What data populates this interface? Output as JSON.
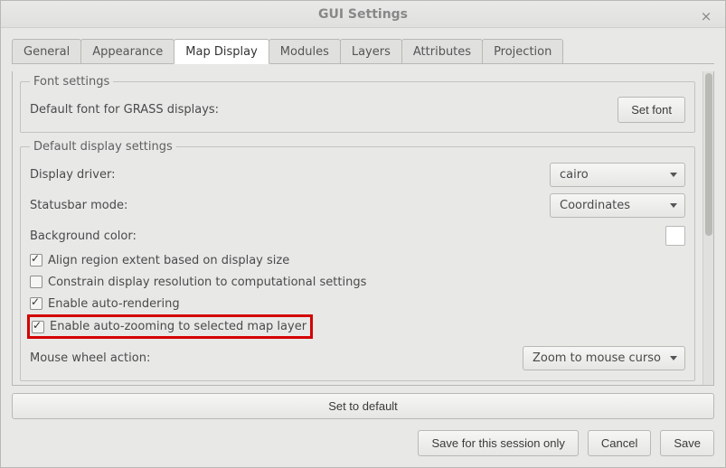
{
  "window": {
    "title": "GUI Settings"
  },
  "tabs": [
    {
      "label": "General"
    },
    {
      "label": "Appearance"
    },
    {
      "label": "Map Display"
    },
    {
      "label": "Modules"
    },
    {
      "label": "Layers"
    },
    {
      "label": "Attributes"
    },
    {
      "label": "Projection"
    }
  ],
  "active_tab_index": 2,
  "font_settings": {
    "legend": "Font settings",
    "default_font_label": "Default font for GRASS displays:",
    "set_font_button": "Set font"
  },
  "display_settings": {
    "legend": "Default display settings",
    "driver_label": "Display driver:",
    "driver_value": "cairo",
    "statusbar_label": "Statusbar mode:",
    "statusbar_value": "Coordinates",
    "bg_color_label": "Background color:",
    "bg_color_value": "#ffffff",
    "check_align": {
      "label": "Align region extent based on display size",
      "checked": true
    },
    "check_constrain": {
      "label": "Constrain display resolution to computational settings",
      "checked": false
    },
    "check_autorender": {
      "label": "Enable auto-rendering",
      "checked": true
    },
    "check_autozoom": {
      "label": "Enable auto-zooming to selected map layer",
      "checked": true
    },
    "wheel_label": "Mouse wheel action:",
    "wheel_value": "Zoom to mouse curso"
  },
  "buttons": {
    "set_default": "Set to default",
    "save_session": "Save for this session only",
    "cancel": "Cancel",
    "save": "Save"
  }
}
